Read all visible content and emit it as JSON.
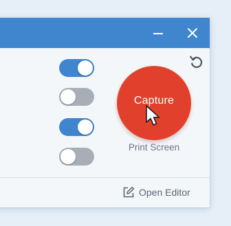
{
  "window": {
    "controls": {
      "minimize_icon": "minimize-icon",
      "close_icon": "close-icon"
    }
  },
  "capture": {
    "label": "Capture",
    "shortcut": "Print Screen",
    "color": "#e1412c"
  },
  "toggles": [
    {
      "state": "on"
    },
    {
      "state": "off"
    },
    {
      "state": "on"
    },
    {
      "state": "off"
    }
  ],
  "footer": {
    "open_editor_label": "Open Editor",
    "open_editor_icon": "edit-icon"
  },
  "colors": {
    "accent": "#3f86cf",
    "toggle_off": "#a7aeb8",
    "window_bg": "#f4f7fa"
  },
  "icons": {
    "refresh": "refresh-icon",
    "cursor": "mouse-cursor-icon"
  }
}
